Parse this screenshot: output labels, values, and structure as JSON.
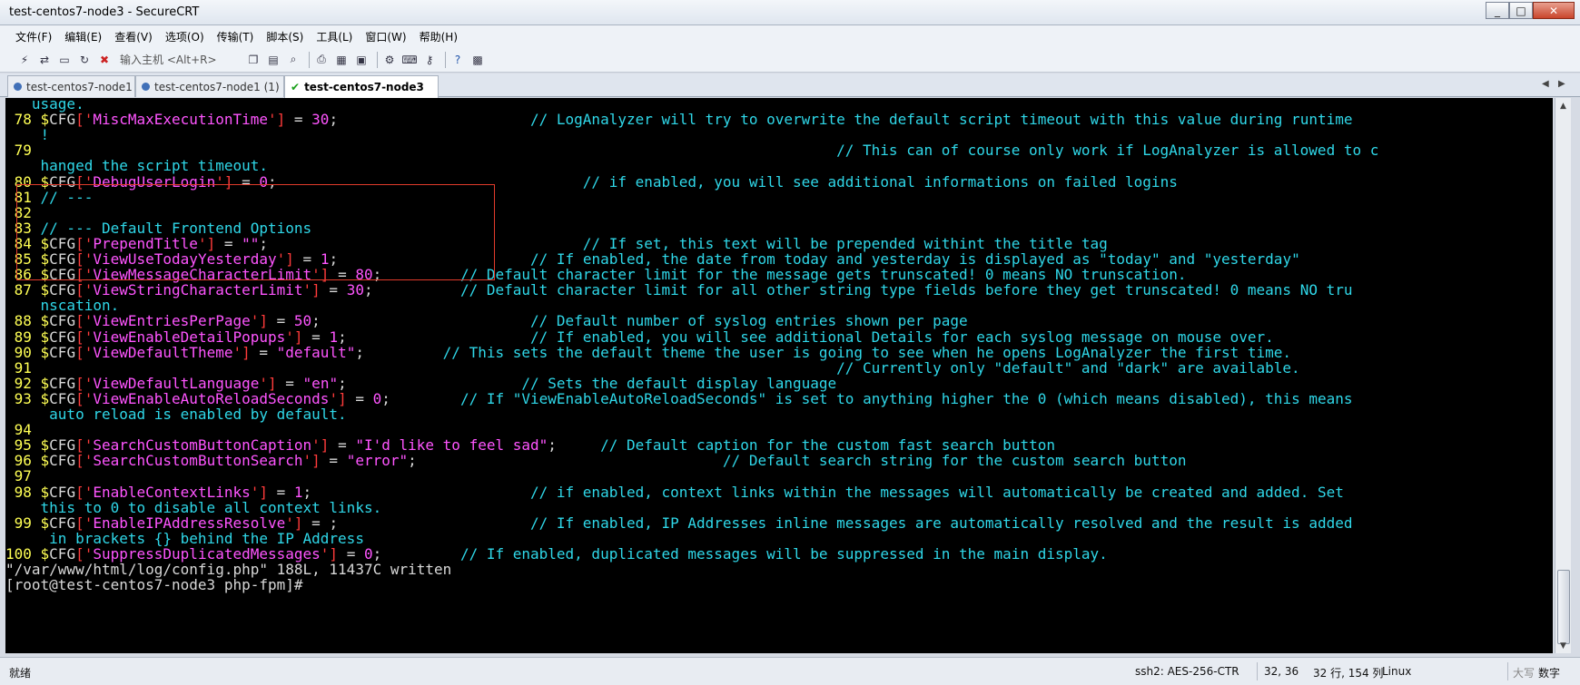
{
  "window": {
    "title": "test-centos7-node3 - SecureCRT",
    "minimize": "_",
    "maximize": "□",
    "close": "✕"
  },
  "menu": [
    "文件(F)",
    "编辑(E)",
    "查看(V)",
    "选项(O)",
    "传输(T)",
    "脚本(S)",
    "工具(L)",
    "窗口(W)",
    "帮助(H)"
  ],
  "toolbar": {
    "host_input_placeholder": "输入主机 <Alt+R>",
    "icons": [
      "connect-icon",
      "quick-connect-icon",
      "connect-tab-icon",
      "reconnect-icon",
      "disconnect-icon",
      "copy-icon",
      "paste-icon",
      "find-icon",
      "print-icon",
      "print-setup-icon",
      "log-session-icon",
      "session-options-icon",
      "keymap-icon",
      "sftp-icon",
      "help-icon",
      "map-icon"
    ]
  },
  "tabs": [
    {
      "label": "test-centos7-node1",
      "state": "inactive"
    },
    {
      "label": "test-centos7-node1 (1)",
      "state": "inactive"
    },
    {
      "label": "test-centos7-node3",
      "state": "active",
      "close": "✕"
    }
  ],
  "terminal": {
    "lines": [
      [
        {
          "t": "   usage.",
          "c": "c"
        }
      ],
      [
        {
          "t": " 78 ",
          "c": "ln"
        },
        {
          "t": "$",
          "c": "y"
        },
        {
          "t": "CFG",
          "c": "w"
        },
        {
          "t": "['",
          "c": "r"
        },
        {
          "t": "MiscMaxExecutionTime",
          "c": "m"
        },
        {
          "t": "']",
          "c": "r"
        },
        {
          "t": " = ",
          "c": "w"
        },
        {
          "t": "30",
          "c": "p"
        },
        {
          "t": ";                      ",
          "c": "w"
        },
        {
          "t": "// LogAnalyzer will try to overwrite the default script timeout with this value during runtime",
          "c": "c"
        }
      ],
      [
        {
          "t": "    !",
          "c": "c"
        }
      ],
      [
        {
          "t": " 79                                                                                            ",
          "c": "ln"
        },
        {
          "t": "// This can of course only work if LogAnalyzer is allowed to c",
          "c": "c"
        }
      ],
      [
        {
          "t": "    hanged the script timeout.",
          "c": "c"
        }
      ],
      [
        {
          "t": " 80 ",
          "c": "ln"
        },
        {
          "t": "$",
          "c": "y"
        },
        {
          "t": "CFG",
          "c": "w"
        },
        {
          "t": "['",
          "c": "r"
        },
        {
          "t": "DebugUserLogin",
          "c": "m"
        },
        {
          "t": "']",
          "c": "r"
        },
        {
          "t": " = ",
          "c": "w"
        },
        {
          "t": "0",
          "c": "p"
        },
        {
          "t": ";                                   ",
          "c": "w"
        },
        {
          "t": "// if enabled, you will see additional informations on failed logins",
          "c": "c"
        }
      ],
      [
        {
          "t": " 81 ",
          "c": "ln"
        },
        {
          "t": "// ---",
          "c": "c"
        }
      ],
      [
        {
          "t": " 82",
          "c": "ln"
        }
      ],
      [
        {
          "t": " 83 ",
          "c": "ln"
        },
        {
          "t": "// --- Default Frontend Options",
          "c": "c"
        }
      ],
      [
        {
          "t": " 84 ",
          "c": "ln"
        },
        {
          "t": "$",
          "c": "y"
        },
        {
          "t": "CFG",
          "c": "w"
        },
        {
          "t": "['",
          "c": "r"
        },
        {
          "t": "PrependTitle",
          "c": "m"
        },
        {
          "t": "']",
          "c": "r"
        },
        {
          "t": " = ",
          "c": "w"
        },
        {
          "t": "\"\"",
          "c": "p"
        },
        {
          "t": ";                                    ",
          "c": "w"
        },
        {
          "t": "// If set, this text will be prepended withint the title tag",
          "c": "c"
        }
      ],
      [
        {
          "t": " 85 ",
          "c": "ln"
        },
        {
          "t": "$",
          "c": "y"
        },
        {
          "t": "CFG",
          "c": "w"
        },
        {
          "t": "['",
          "c": "r"
        },
        {
          "t": "ViewUseTodayYesterday",
          "c": "m"
        },
        {
          "t": "']",
          "c": "r"
        },
        {
          "t": " = ",
          "c": "w"
        },
        {
          "t": "1",
          "c": "p"
        },
        {
          "t": ";                      ",
          "c": "w"
        },
        {
          "t": "// If enabled, the date from today and yesterday is displayed as \"today\" and \"yesterday\"",
          "c": "c"
        }
      ],
      [
        {
          "t": " 86 ",
          "c": "ln"
        },
        {
          "t": "$",
          "c": "y"
        },
        {
          "t": "CFG",
          "c": "w"
        },
        {
          "t": "['",
          "c": "r"
        },
        {
          "t": "ViewMessageCharacterLimit",
          "c": "m"
        },
        {
          "t": "']",
          "c": "r"
        },
        {
          "t": " = ",
          "c": "w"
        },
        {
          "t": "80",
          "c": "p"
        },
        {
          "t": ";         ",
          "c": "w"
        },
        {
          "t": "// Default character limit for the message gets trunscated! 0 means NO trunscation.",
          "c": "c"
        }
      ],
      [
        {
          "t": " 87 ",
          "c": "ln"
        },
        {
          "t": "$",
          "c": "y"
        },
        {
          "t": "CFG",
          "c": "w"
        },
        {
          "t": "['",
          "c": "r"
        },
        {
          "t": "ViewStringCharacterLimit",
          "c": "m"
        },
        {
          "t": "']",
          "c": "r"
        },
        {
          "t": " = ",
          "c": "w"
        },
        {
          "t": "30",
          "c": "p"
        },
        {
          "t": ";          ",
          "c": "w"
        },
        {
          "t": "// Default character limit for all other string type fields before they get trunscated! 0 means NO tru",
          "c": "c"
        }
      ],
      [
        {
          "t": "    nscation.",
          "c": "c"
        }
      ],
      [
        {
          "t": " 88 ",
          "c": "ln"
        },
        {
          "t": "$",
          "c": "y"
        },
        {
          "t": "CFG",
          "c": "w"
        },
        {
          "t": "['",
          "c": "r"
        },
        {
          "t": "ViewEntriesPerPage",
          "c": "m"
        },
        {
          "t": "']",
          "c": "r"
        },
        {
          "t": " = ",
          "c": "w"
        },
        {
          "t": "50",
          "c": "p"
        },
        {
          "t": ";                        ",
          "c": "w"
        },
        {
          "t": "// Default number of syslog entries shown per page",
          "c": "c"
        }
      ],
      [
        {
          "t": " 89 ",
          "c": "ln"
        },
        {
          "t": "$",
          "c": "y"
        },
        {
          "t": "CFG",
          "c": "w"
        },
        {
          "t": "['",
          "c": "r"
        },
        {
          "t": "ViewEnableDetailPopups",
          "c": "m"
        },
        {
          "t": "']",
          "c": "r"
        },
        {
          "t": " = ",
          "c": "w"
        },
        {
          "t": "1",
          "c": "p"
        },
        {
          "t": ";                     ",
          "c": "w"
        },
        {
          "t": "// If enabled, you will see additional Details for each syslog message on mouse over.",
          "c": "c"
        }
      ],
      [
        {
          "t": " 90 ",
          "c": "ln"
        },
        {
          "t": "$",
          "c": "y"
        },
        {
          "t": "CFG",
          "c": "w"
        },
        {
          "t": "['",
          "c": "r"
        },
        {
          "t": "ViewDefaultTheme",
          "c": "m"
        },
        {
          "t": "']",
          "c": "r"
        },
        {
          "t": " = ",
          "c": "w"
        },
        {
          "t": "\"default\"",
          "c": "p"
        },
        {
          "t": ";         ",
          "c": "w"
        },
        {
          "t": "// This sets the default theme the user is going to see when he opens LogAnalyzer the first time.",
          "c": "c"
        }
      ],
      [
        {
          "t": " 91                                                                                            ",
          "c": "ln"
        },
        {
          "t": "// Currently only \"default\" and \"dark\" are available.",
          "c": "c"
        }
      ],
      [
        {
          "t": " 92 ",
          "c": "ln"
        },
        {
          "t": "$",
          "c": "y"
        },
        {
          "t": "CFG",
          "c": "w"
        },
        {
          "t": "['",
          "c": "r"
        },
        {
          "t": "ViewDefaultLanguage",
          "c": "m"
        },
        {
          "t": "']",
          "c": "r"
        },
        {
          "t": " = ",
          "c": "w"
        },
        {
          "t": "\"en\"",
          "c": "p"
        },
        {
          "t": ";                    ",
          "c": "w"
        },
        {
          "t": "// Sets the default display language",
          "c": "c"
        }
      ],
      [
        {
          "t": " 93 ",
          "c": "ln"
        },
        {
          "t": "$",
          "c": "y"
        },
        {
          "t": "CFG",
          "c": "w"
        },
        {
          "t": "['",
          "c": "r"
        },
        {
          "t": "ViewEnableAutoReloadSeconds",
          "c": "m"
        },
        {
          "t": "']",
          "c": "r"
        },
        {
          "t": " = ",
          "c": "w"
        },
        {
          "t": "0",
          "c": "p"
        },
        {
          "t": ";        ",
          "c": "w"
        },
        {
          "t": "// If \"ViewEnableAutoReloadSeconds\" is set to anything higher the 0 (which means disabled), this means",
          "c": "c"
        }
      ],
      [
        {
          "t": "     auto reload is enabled by default.",
          "c": "c"
        }
      ],
      [
        {
          "t": " 94",
          "c": "ln"
        }
      ],
      [
        {
          "t": " 95 ",
          "c": "ln"
        },
        {
          "t": "$",
          "c": "y"
        },
        {
          "t": "CFG",
          "c": "w"
        },
        {
          "t": "['",
          "c": "r"
        },
        {
          "t": "SearchCustomButtonCaption",
          "c": "m"
        },
        {
          "t": "']",
          "c": "r"
        },
        {
          "t": " = ",
          "c": "w"
        },
        {
          "t": "\"I'd like to feel sad\"",
          "c": "p"
        },
        {
          "t": ";     ",
          "c": "w"
        },
        {
          "t": "// Default caption for the custom fast search button",
          "c": "c"
        }
      ],
      [
        {
          "t": " 96 ",
          "c": "ln"
        },
        {
          "t": "$",
          "c": "y"
        },
        {
          "t": "CFG",
          "c": "w"
        },
        {
          "t": "['",
          "c": "r"
        },
        {
          "t": "SearchCustomButtonSearch",
          "c": "m"
        },
        {
          "t": "']",
          "c": "r"
        },
        {
          "t": " = ",
          "c": "w"
        },
        {
          "t": "\"error\"",
          "c": "p"
        },
        {
          "t": ";                                   ",
          "c": "w"
        },
        {
          "t": "// Default search string for the custom search button",
          "c": "c"
        }
      ],
      [
        {
          "t": " 97",
          "c": "ln"
        }
      ],
      [
        {
          "t": " 98 ",
          "c": "ln"
        },
        {
          "t": "$",
          "c": "y"
        },
        {
          "t": "CFG",
          "c": "w"
        },
        {
          "t": "['",
          "c": "r"
        },
        {
          "t": "EnableContextLinks",
          "c": "m"
        },
        {
          "t": "']",
          "c": "r"
        },
        {
          "t": " = ",
          "c": "w"
        },
        {
          "t": "1",
          "c": "p"
        },
        {
          "t": ";                         ",
          "c": "w"
        },
        {
          "t": "// if enabled, context links within the messages will automatically be created and added. Set",
          "c": "c"
        }
      ],
      [
        {
          "t": "    this to 0 to disable all context links.",
          "c": "c"
        }
      ],
      [
        {
          "t": " 99 ",
          "c": "ln"
        },
        {
          "t": "$",
          "c": "y"
        },
        {
          "t": "CFG",
          "c": "w"
        },
        {
          "t": "['",
          "c": "r"
        },
        {
          "t": "EnableIPAddressResolve",
          "c": "m"
        },
        {
          "t": "']",
          "c": "r"
        },
        {
          "t": " = ",
          "c": "w"
        },
        {
          "t": ";",
          "c": "w"
        },
        {
          "t": "                      ",
          "c": "w"
        },
        {
          "t": "// If enabled, IP Addresses inline messages are automatically resolved and the result is added",
          "c": "c"
        }
      ],
      [
        {
          "t": "     in brackets {} behind the IP Address",
          "c": "c"
        }
      ],
      [
        {
          "t": "100 ",
          "c": "ln"
        },
        {
          "t": "$",
          "c": "y"
        },
        {
          "t": "CFG",
          "c": "w"
        },
        {
          "t": "['",
          "c": "r"
        },
        {
          "t": "SuppressDuplicatedMessages",
          "c": "m"
        },
        {
          "t": "']",
          "c": "r"
        },
        {
          "t": " = ",
          "c": "w"
        },
        {
          "t": "0",
          "c": "p"
        },
        {
          "t": ";         ",
          "c": "w"
        },
        {
          "t": "// If enabled, duplicated messages will be suppressed in the main display.",
          "c": "c"
        }
      ],
      [
        {
          "t": "\"/var/www/html/log/config.php\" 188L, 11437C written",
          "c": "w"
        }
      ],
      [
        {
          "t": "[root@test-centos7-node3 php-fpm]#",
          "c": "w"
        }
      ]
    ]
  },
  "status": {
    "ready": "就绪",
    "cipher": "ssh2: AES-256-CTR",
    "cursor": "32,  36",
    "rows_cols": "32 行, 154 列",
    "os": "Linux",
    "caps": "大写",
    "num": "数字"
  }
}
